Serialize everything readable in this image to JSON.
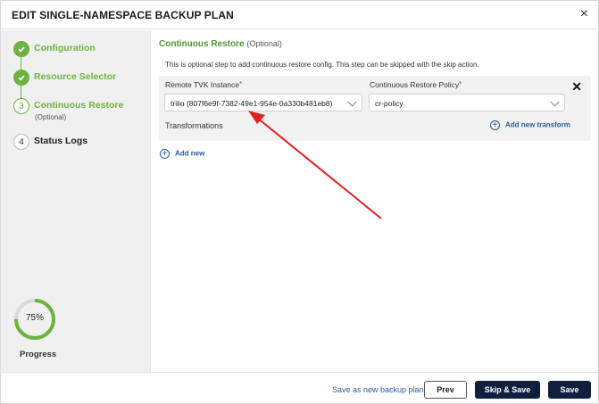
{
  "header": {
    "title": "EDIT SINGLE-NAMESPACE BACKUP PLAN",
    "close_glyph": "×"
  },
  "steps": [
    {
      "number": "",
      "label": "Configuration",
      "status": "done"
    },
    {
      "number": "",
      "label": "Resource Selector",
      "status": "done"
    },
    {
      "number": "3",
      "label": "Continuous Restore",
      "sub": "(Optional)",
      "status": "current"
    },
    {
      "number": "4",
      "label": "Status Logs",
      "status": "todo"
    }
  ],
  "progress": {
    "value": 75,
    "text": "75%",
    "label": "Progress"
  },
  "section": {
    "title": "Continuous Restore",
    "optional": "(Optional)",
    "description": "This is optional step to add continuous restore config. This step can be skipped with the skip action."
  },
  "restore_entry": {
    "remote_tvk_label": "Remote TVK Instance",
    "remote_tvk_value": "trilio (807f6e9f-7382-49e1-954e-0a330b481eb8)",
    "policy_label": "Continuous Restore Policy",
    "policy_value": "cr-policy",
    "required_mark": "*",
    "transformations_label": "Transformations",
    "add_transform_label": "Add new transform",
    "remove_glyph": "✕"
  },
  "add_new_label": "Add new",
  "footer": {
    "save_as_new_label": "Save as new backup plan",
    "prev_label": "Prev",
    "skip_save_label": "Skip & Save",
    "save_label": "Save"
  },
  "colors": {
    "accent_green": "#6db33f",
    "primary_navy": "#0f1f3d",
    "link_blue": "#2c5aa0",
    "annotation_red": "#e02020"
  }
}
